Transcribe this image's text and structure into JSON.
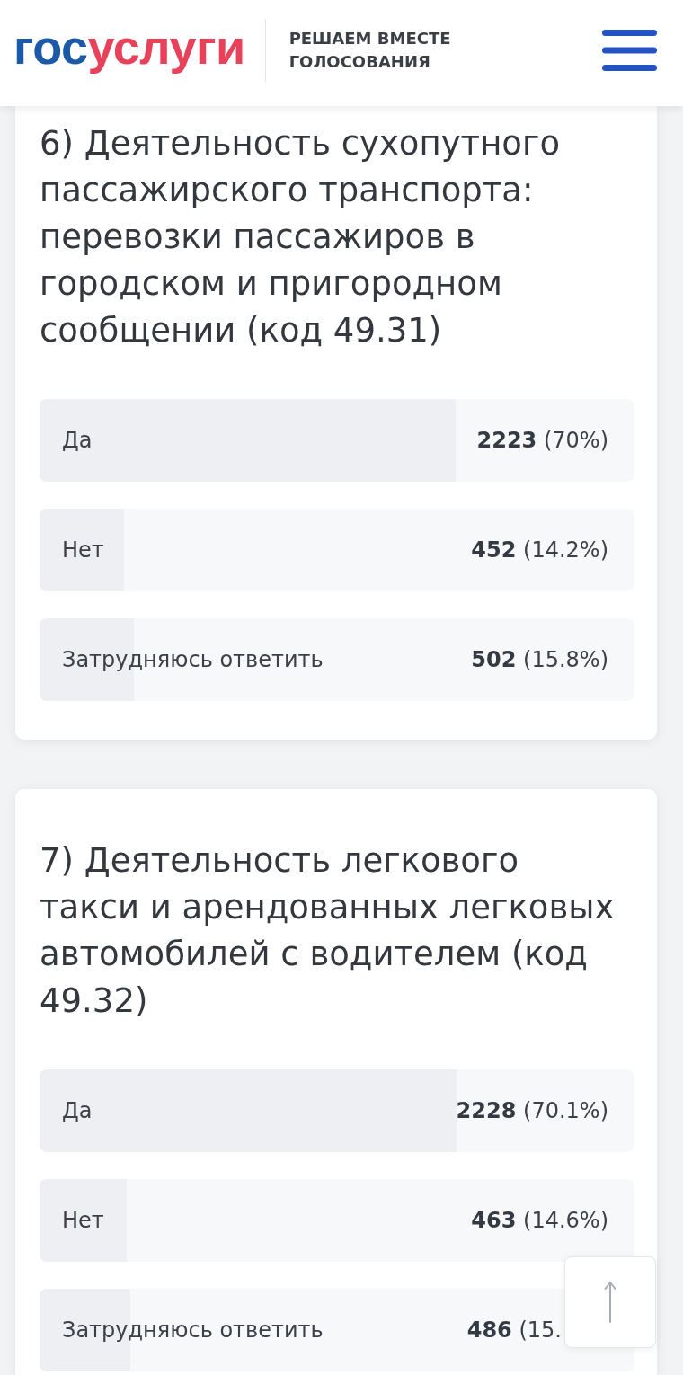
{
  "header": {
    "logo": [
      {
        "text": "гос",
        "color": "#1c5aa8"
      },
      {
        "text": "услуги",
        "color": "#e8415a"
      }
    ],
    "title_lines": [
      "РЕШАЕМ ВМЕСТЕ",
      "ГОЛОСОВАНИЯ"
    ]
  },
  "questions": [
    {
      "title": "6) Деятельность сухопутного пассажирского транспорта: перевозки пассажиров в городском и пригородном сообщении (код 49.31)",
      "options": [
        {
          "label": "Да",
          "result": "**2223** (70%)",
          "level": 0.7,
          "partly_covered": false
        },
        {
          "label": "Нет",
          "result": "**452** (14.2%)",
          "level": 0.142,
          "partly_covered": false
        },
        {
          "label": "Затрудняюсь ответить",
          "result": "**502** (15.8%)",
          "level": 0.158,
          "partly_covered": false
        }
      ]
    },
    {
      "title": "7) Деятельность легкового такси и арендованных легковых автомобилей с водителем (код 49.32)",
      "options": [
        {
          "label": "Да",
          "result": "**2228** (70.1%)",
          "level": 0.701,
          "partly_covered": false
        },
        {
          "label": "Нет",
          "result": "**463** (14.6%)",
          "level": 0.146,
          "partly_covered": false
        },
        {
          "label": "Затрудняюсь ответить",
          "result": "**486** (15.",
          "level": 0.153,
          "partly_covered": true
        }
      ]
    }
  ]
}
